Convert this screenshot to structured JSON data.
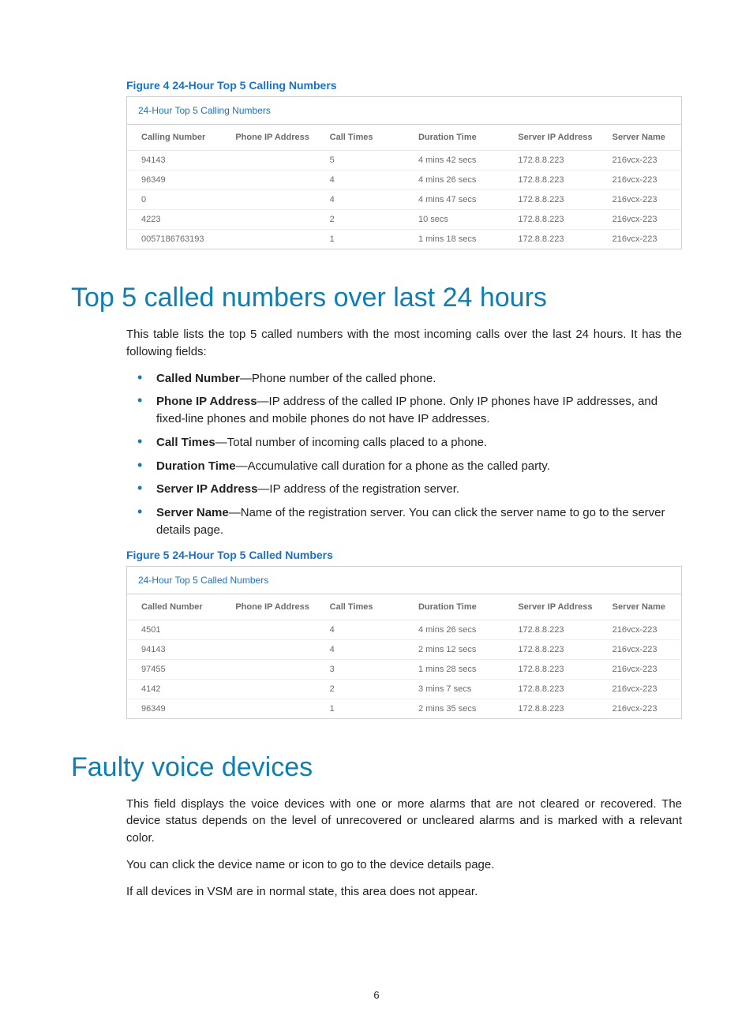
{
  "figure4": {
    "caption": "Figure 4 24-Hour Top 5 Calling Numbers",
    "panel_title": "24-Hour Top 5 Calling Numbers",
    "headers": [
      "Calling Number",
      "Phone IP Address",
      "Call Times",
      "Duration Time",
      "Server IP Address",
      "Server Name"
    ],
    "rows": [
      {
        "num": "94143",
        "ip": "",
        "times": "5",
        "dur": "4 mins 42 secs",
        "sip": "172.8.8.223",
        "sname": "216vcx-223"
      },
      {
        "num": "96349",
        "ip": "",
        "times": "4",
        "dur": "4 mins 26 secs",
        "sip": "172.8.8.223",
        "sname": "216vcx-223"
      },
      {
        "num": "0",
        "ip": "",
        "times": "4",
        "dur": "4 mins 47 secs",
        "sip": "172.8.8.223",
        "sname": "216vcx-223"
      },
      {
        "num": "4223",
        "ip": "",
        "times": "2",
        "dur": "10 secs",
        "sip": "172.8.8.223",
        "sname": "216vcx-223"
      },
      {
        "num": "0057186763193",
        "ip": "",
        "times": "1",
        "dur": "1 mins 18 secs",
        "sip": "172.8.8.223",
        "sname": "216vcx-223"
      }
    ]
  },
  "section1": {
    "heading": "Top 5 called numbers over last 24 hours",
    "intro": "This table lists the top 5 called numbers with the most incoming calls over the last 24 hours. It has the following fields:",
    "bullets": [
      {
        "term": "Called Number",
        "desc": "—Phone number of the called phone."
      },
      {
        "term": "Phone IP Address",
        "desc": "—IP address of the called IP phone. Only IP phones have IP addresses, and fixed-line phones and mobile phones do not have IP addresses."
      },
      {
        "term": "Call Times",
        "desc": "—Total number of incoming calls placed to a phone."
      },
      {
        "term": "Duration Time",
        "desc": "—Accumulative call duration for a phone as the called party."
      },
      {
        "term": "Server IP Address",
        "desc": "—IP address of the registration server."
      },
      {
        "term": "Server Name",
        "desc": "—Name of the registration server. You can click the server name to go to the server details page."
      }
    ]
  },
  "figure5": {
    "caption": "Figure 5 24-Hour Top 5 Called Numbers",
    "panel_title": "24-Hour Top 5 Called Numbers",
    "headers": [
      "Called Number",
      "Phone IP Address",
      "Call Times",
      "Duration Time",
      "Server IP Address",
      "Server Name"
    ],
    "rows": [
      {
        "num": "4501",
        "ip": "",
        "times": "4",
        "dur": "4 mins 26 secs",
        "sip": "172.8.8.223",
        "sname": "216vcx-223"
      },
      {
        "num": "94143",
        "ip": "",
        "times": "4",
        "dur": "2 mins 12 secs",
        "sip": "172.8.8.223",
        "sname": "216vcx-223"
      },
      {
        "num": "97455",
        "ip": "",
        "times": "3",
        "dur": "1 mins 28 secs",
        "sip": "172.8.8.223",
        "sname": "216vcx-223"
      },
      {
        "num": "4142",
        "ip": "",
        "times": "2",
        "dur": "3 mins 7 secs",
        "sip": "172.8.8.223",
        "sname": "216vcx-223"
      },
      {
        "num": "96349",
        "ip": "",
        "times": "1",
        "dur": "2 mins 35 secs",
        "sip": "172.8.8.223",
        "sname": "216vcx-223"
      }
    ]
  },
  "section2": {
    "heading": "Faulty voice devices",
    "paragraphs": [
      "This field displays the voice devices with one or more alarms that are not cleared or recovered. The device status depends on the level of unrecovered or uncleared alarms and is marked with a relevant color.",
      "You can click the device name or icon to go to the device details page.",
      "If all devices in VSM are in normal state, this area does not appear."
    ]
  },
  "page_number": "6"
}
